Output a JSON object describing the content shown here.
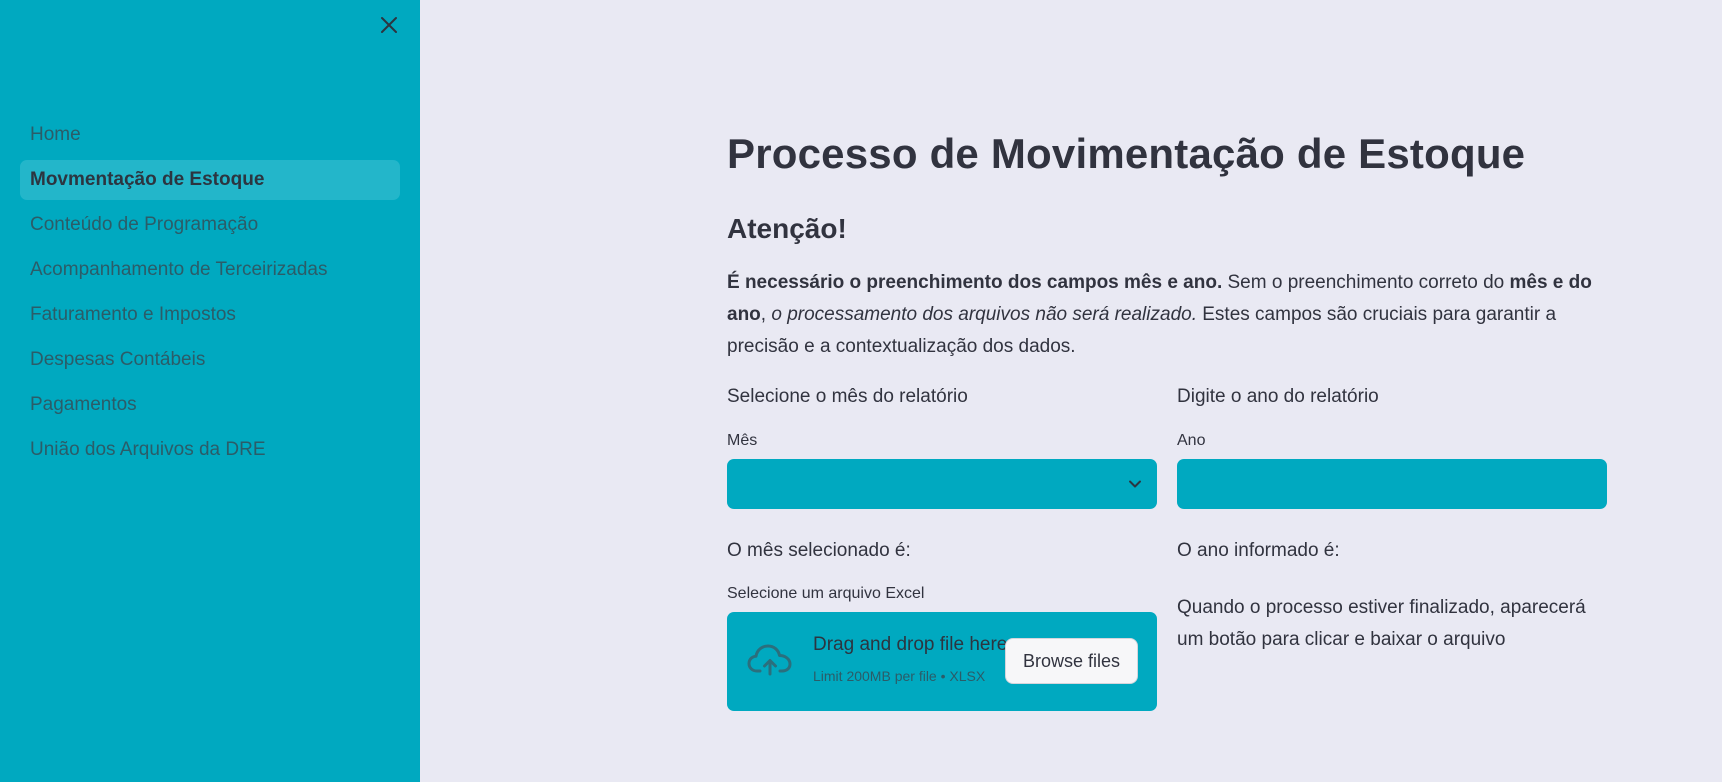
{
  "sidebar": {
    "items": [
      {
        "label": "Home"
      },
      {
        "label": "Movmentação de Estoque",
        "active": true
      },
      {
        "label": "Conteúdo de Programação"
      },
      {
        "label": "Acompanhamento de Terceirizadas"
      },
      {
        "label": "Faturamento e Impostos"
      },
      {
        "label": "Despesas Contábeis"
      },
      {
        "label": "Pagamentos"
      },
      {
        "label": "União dos Arquivos da DRE"
      }
    ]
  },
  "main": {
    "title": "Processo de Movimentação de Estoque",
    "section_title": "Atenção!",
    "paragraph": {
      "bold1": "É necessário o preenchimento dos campos mês e ano.",
      "text1": " Sem o preenchimento correto do ",
      "bold2": "mês e do ano",
      "text2": ", ",
      "italic": "o processamento dos arquivos não será realizado.",
      "text3": " Estes campos são cruciais para garantir a precisão e a contextualização dos dados."
    },
    "left": {
      "heading": "Selecione o mês do relatório",
      "field_label": "Mês",
      "select_value": "",
      "result": "O mês selecionado é:",
      "upload_label": "Selecione um arquivo Excel",
      "dropzone_title": "Drag and drop file here",
      "dropzone_limit": "Limit 200MB per file • XLSX",
      "browse_label": "Browse files"
    },
    "right": {
      "heading": "Digite o ano do relatório",
      "field_label": "Ano",
      "input_value": "",
      "result": "O ano informado é:",
      "info": "Quando o processo estiver finalizado, aparecerá um botão para clicar e baixar o arquivo"
    }
  },
  "colors": {
    "sidebar_bg": "#00a9c0",
    "main_bg": "#e9e9f3",
    "input_bg": "#00a9c0",
    "active_item_bg": "#23b6ca",
    "text": "#31333f"
  },
  "icons": {
    "close": "close-icon",
    "chevron": "chevron-down-icon",
    "upload": "cloud-upload-icon"
  }
}
